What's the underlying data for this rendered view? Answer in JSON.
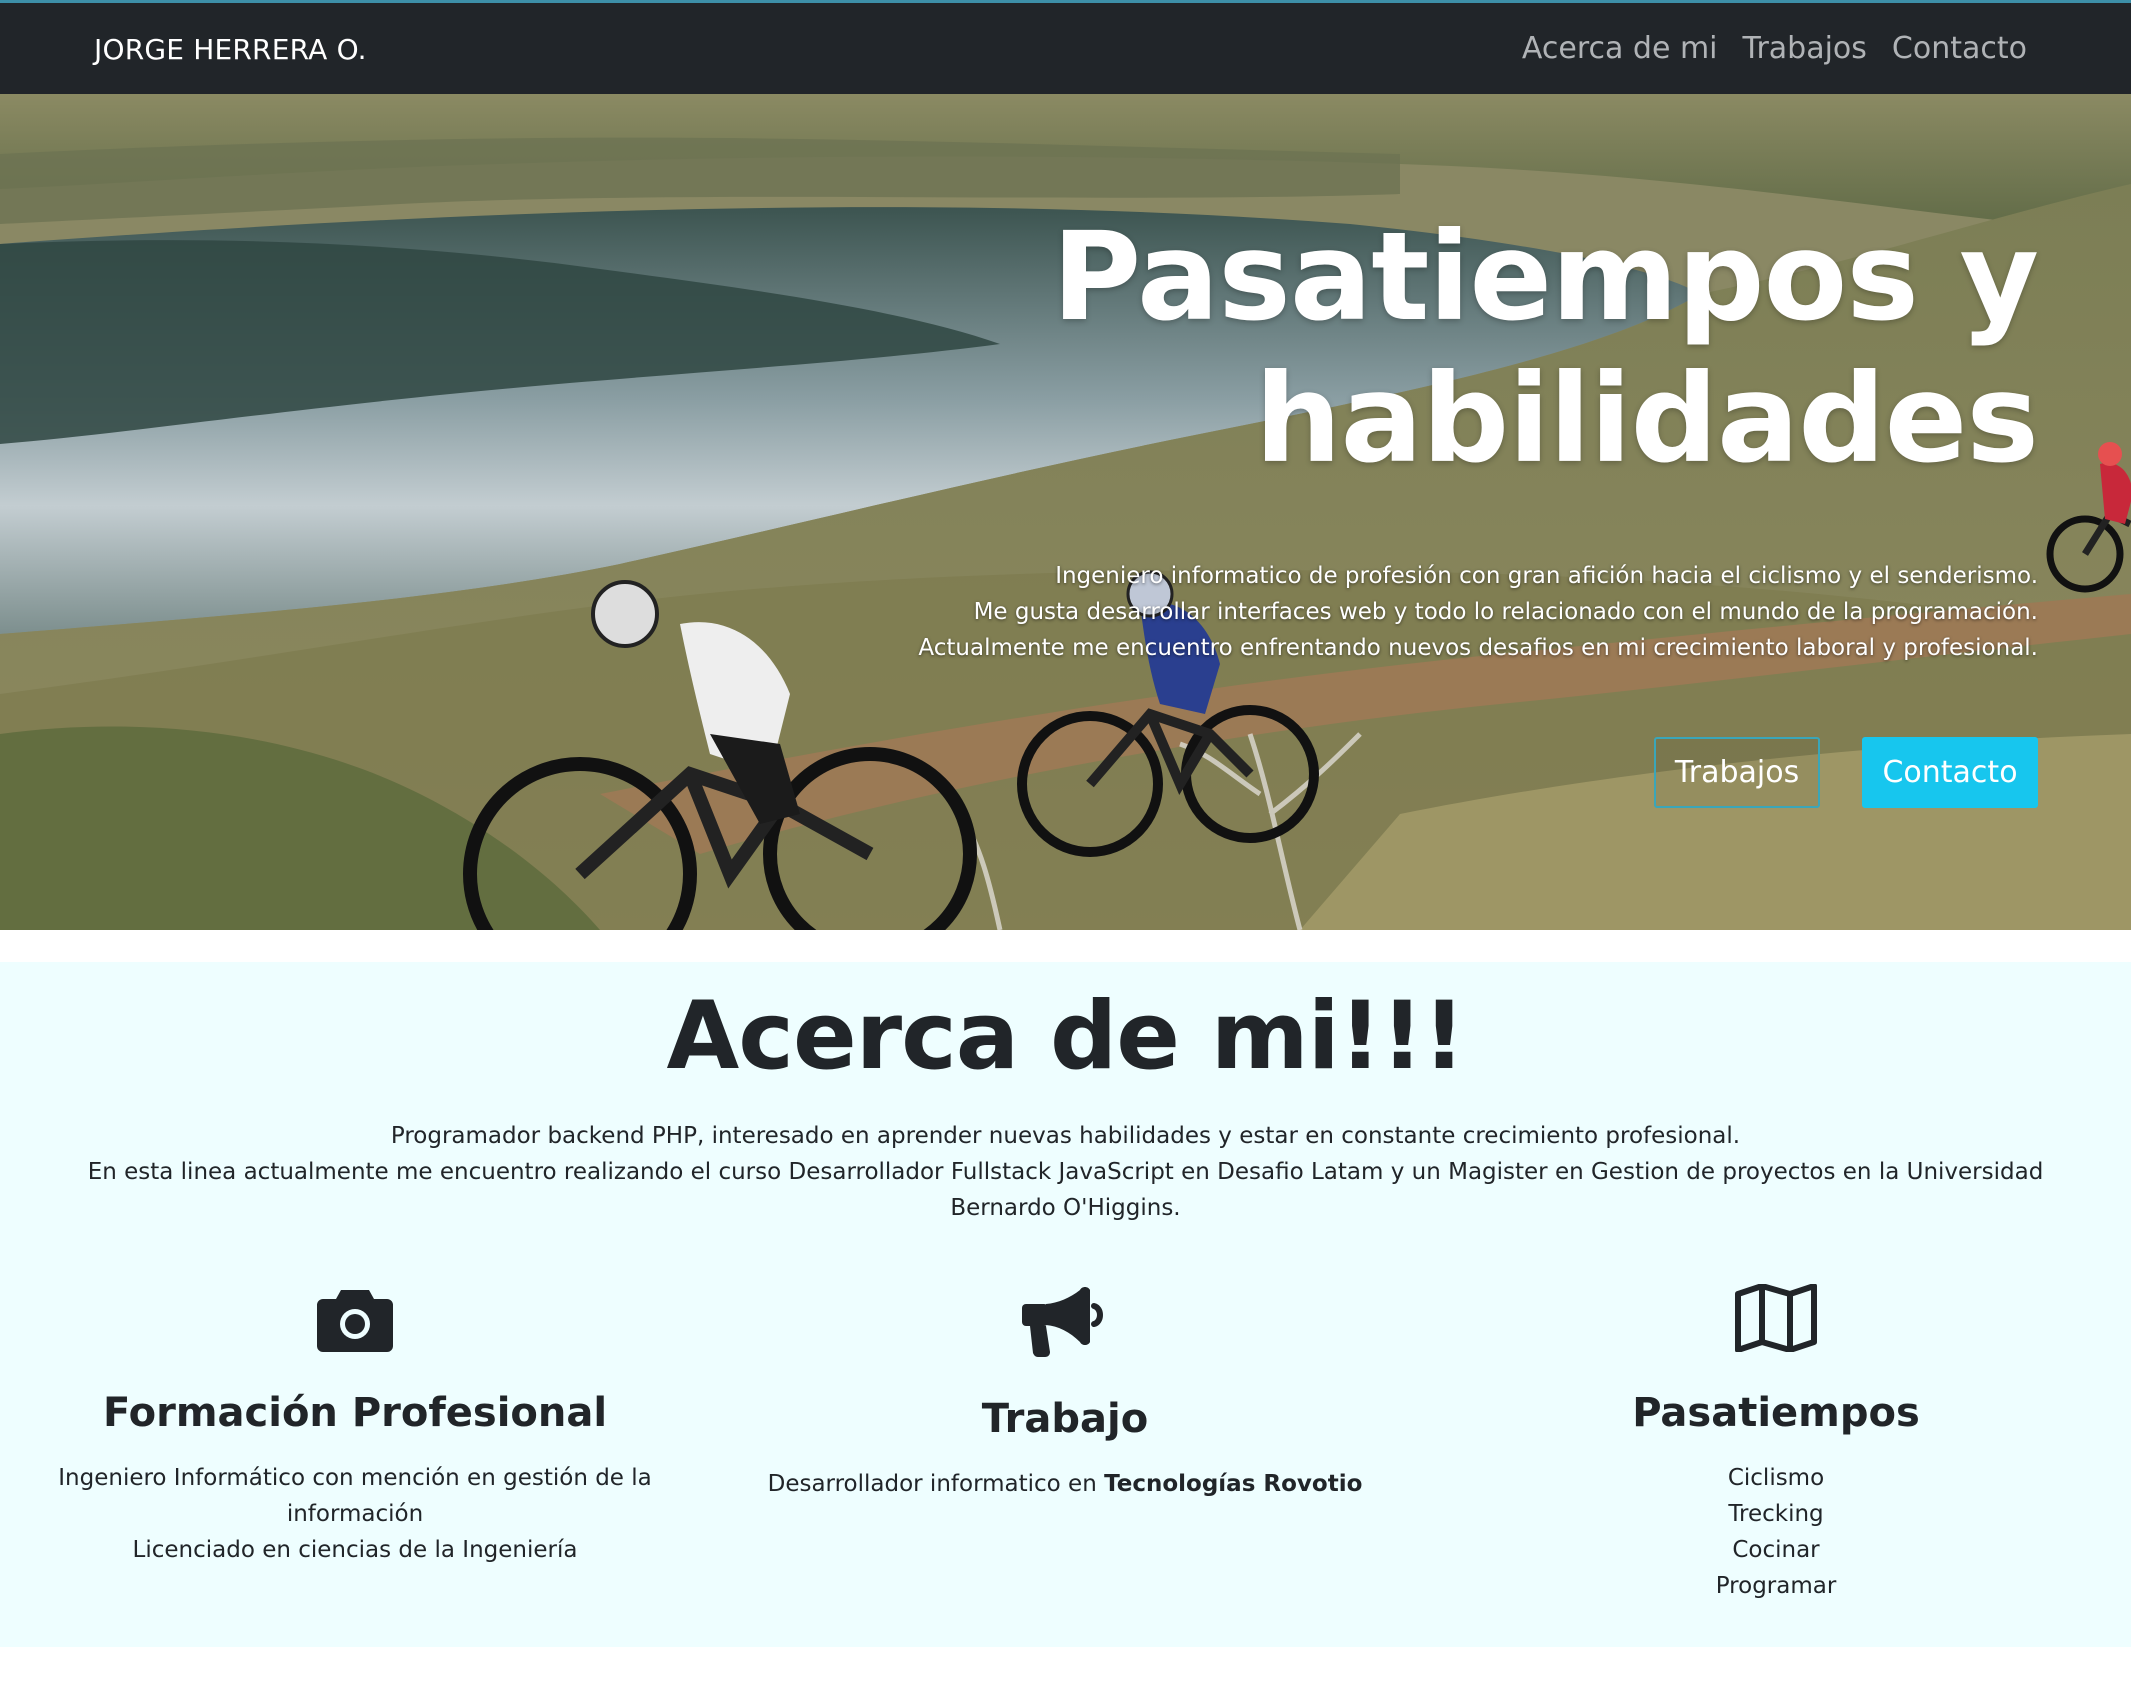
{
  "navbar": {
    "brand": "JORGE HERRERA O.",
    "links": [
      "Acerca de mi",
      "Trabajos",
      "Contacto"
    ]
  },
  "hero": {
    "title": "Pasatiempos y habilidades",
    "description": [
      "Ingeniero informatico de profesión con gran afición hacia el ciclismo y el senderismo.",
      "Me gusta desarrollar interfaces web y todo lo relacionado con el mundo de la programación.",
      "Actualmente me encuentro enfrentando nuevos desafios en mi crecimiento laboral y profesional."
    ],
    "buttons": {
      "works": "Trabajos",
      "contact": "Contacto"
    },
    "image": "mountain-bikers-by-lake"
  },
  "about": {
    "title": "Acerca de mi!!!",
    "lines": [
      "Programador backend PHP, interesado en aprender nuevas habilidades y estar en constante crecimiento profesional.",
      "En esta linea actualmente me encuentro realizando el curso Desarrollador Fullstack JavaScript en Desafio Latam y un Magister en Gestion de proyectos en la Universidad Bernardo O'Higgins."
    ],
    "columns": [
      {
        "icon": "camera-icon",
        "title": "Formación Profesional",
        "lines": [
          "Ingeniero Informático con mención en gestión de la información",
          "Licenciado en ciencias de la Ingeniería"
        ]
      },
      {
        "icon": "megaphone-icon",
        "title": "Trabajo",
        "prefix": "Desarrollador informatico en ",
        "company": "Tecnologías Rovotio"
      },
      {
        "icon": "map-icon",
        "title": "Pasatiempos",
        "lines": [
          "Ciclismo",
          "Trecking",
          "Cocinar",
          "Programar"
        ]
      }
    ]
  },
  "colors": {
    "navbar_bg": "#212529",
    "accent": "#17c6ee",
    "about_bg": "#eefeff",
    "text": "#212529"
  }
}
